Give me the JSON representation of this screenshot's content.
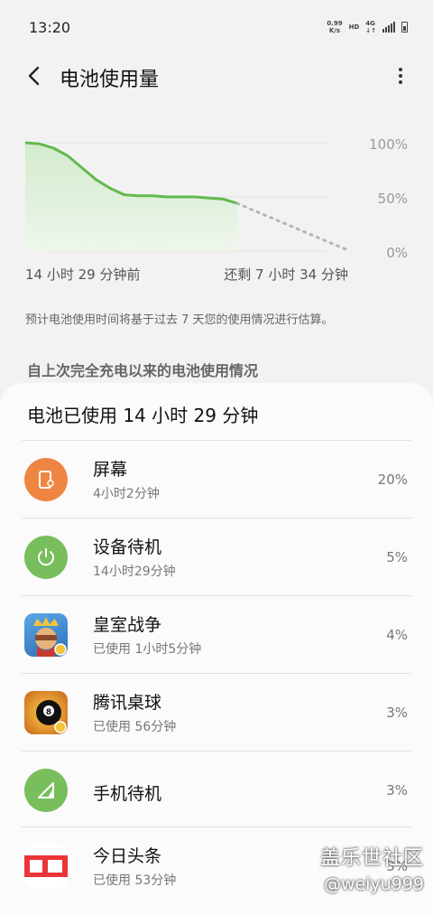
{
  "status_bar": {
    "time": "13:20",
    "net_speed_value": "0.99",
    "net_speed_unit": "K/s",
    "hd": "HD",
    "network": "4G"
  },
  "header": {
    "title": "电池使用量"
  },
  "chart_data": {
    "type": "area",
    "title": "",
    "yticks": [
      "100%",
      "50%",
      "0%"
    ],
    "ylim": [
      0,
      100
    ],
    "xlabels": [
      "14 小时 29 分钟前",
      "还剩 7 小时 34 分钟"
    ],
    "series": [
      {
        "values": [
          100,
          99,
          95,
          88,
          77,
          66,
          58,
          52,
          51,
          51,
          50,
          50,
          50,
          49,
          48,
          44
        ],
        "color": "#62b94d"
      },
      {
        "values": [
          44,
          0
        ],
        "color": "#b5b5b5",
        "style": "dotted"
      }
    ]
  },
  "note": "预计电池使用时间将基于过去 7 天您的使用情况进行估算。",
  "section_title": "自上次完全充电以来的电池使用情况",
  "usage": {
    "title": "电池已使用 14 小时 29 分钟",
    "items": [
      {
        "name": "屏幕",
        "sub": "4小时2分钟",
        "pct": "20%",
        "icon": "screen-icon",
        "color": "#ef8543"
      },
      {
        "name": "设备待机",
        "sub": "14小时29分钟",
        "pct": "5%",
        "icon": "power-icon",
        "color": "#78be5c"
      },
      {
        "name": "皇室战争",
        "sub": "已使用 1小时5分钟",
        "pct": "4%",
        "icon": "clash-royale-icon",
        "color": "#3a8ad0"
      },
      {
        "name": "腾讯桌球",
        "sub": "已使用 56分钟",
        "pct": "3%",
        "icon": "billiards-icon",
        "color": "#e8b424"
      },
      {
        "name": "手机待机",
        "sub": "",
        "pct": "3%",
        "icon": "signal-icon",
        "color": "#78be5c"
      },
      {
        "name": "今日头条",
        "sub": "已使用 53分钟",
        "pct": "3%",
        "icon": "toutiao-icon",
        "color": "#ed3437"
      }
    ]
  },
  "watermark": {
    "line1": "盖乐世社区",
    "line2": "@weiyu999"
  }
}
